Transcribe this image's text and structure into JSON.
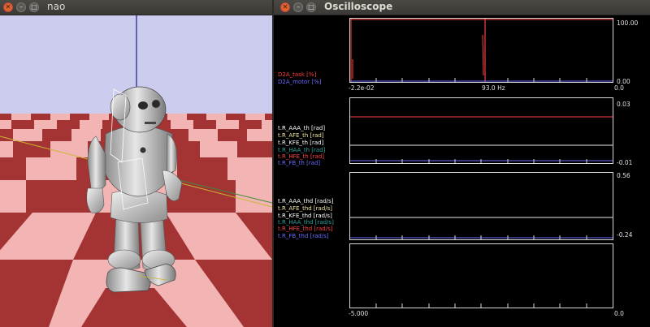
{
  "nao_window": {
    "title": "nao",
    "colors": {
      "sky": "#ccccee",
      "floor_light": "#f3b4b4",
      "floor_dark": "#a43434"
    }
  },
  "oscilloscope": {
    "title": "Oscilloscope",
    "panels": [
      {
        "labels": [
          {
            "text": "D2A_task [%]",
            "color": "#ff4040"
          },
          {
            "text": "D2A_motor [%]",
            "color": "#6b6bff"
          }
        ],
        "y_max": "100.00",
        "y_min": "0.00",
        "x_left": "-2.2e-02",
        "x_mid": "93.0 Hz",
        "x_right": "0.0"
      },
      {
        "labels": [
          {
            "text": "t.R_AAA_th [rad]",
            "color": "#ffffff"
          },
          {
            "text": "t.R_AFE_th [rad]",
            "color": "#f0e6a0"
          },
          {
            "text": "t.R_KFE_th [rad]",
            "color": "#ffffff"
          },
          {
            "text": "t.R_HAA_th [rad]",
            "color": "#2aa39c"
          },
          {
            "text": "t.R_HFE_th [rad]",
            "color": "#ff4040"
          },
          {
            "text": "t.R_FB_th [rad]",
            "color": "#6b6bff"
          }
        ],
        "y_max": "0.03",
        "y_min": "-0.01"
      },
      {
        "labels": [
          {
            "text": "t.R_AAA_thd [rad/s]",
            "color": "#ffffff"
          },
          {
            "text": "t.R_AFE_thd [rad/s]",
            "color": "#f0e6a0"
          },
          {
            "text": "t.R_KFE_thd [rad/s]",
            "color": "#ffffff"
          },
          {
            "text": "t.R_HAA_thd [rad/s]",
            "color": "#2aa39c"
          },
          {
            "text": "t.R_HFE_thd [rad/s]",
            "color": "#ff4040"
          },
          {
            "text": "t.R_FB_thd [rad/s]",
            "color": "#6b6bff"
          }
        ],
        "y_max": "0.56",
        "y_min": "-0.24"
      },
      {
        "labels": [],
        "x_left": "-5.000",
        "x_right": "0.0"
      }
    ]
  }
}
